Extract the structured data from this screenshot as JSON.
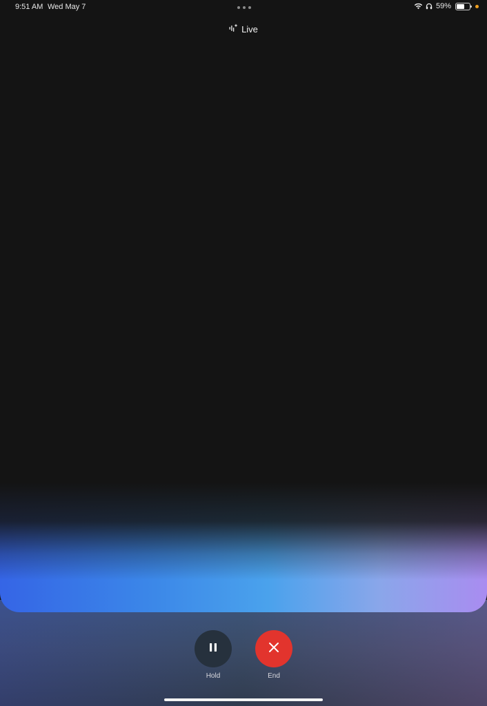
{
  "status_bar": {
    "time": "9:51 AM",
    "date": "Wed May 7",
    "battery_percent": "59%",
    "battery_level": 0.59,
    "icons": [
      "multitasking-dots-icon",
      "wifi-icon",
      "headphones-icon",
      "battery-icon",
      "privacy-indicator-dot"
    ]
  },
  "header": {
    "title": "Live",
    "icon": "live-sparkle-waveform-icon"
  },
  "controls": {
    "hold_label": "Hold",
    "hold_icon": "pause-icon",
    "end_label": "End",
    "end_icon": "close-icon"
  },
  "colors": {
    "background": "#141414",
    "end_button": "#e2342d",
    "hold_button": "#26313d",
    "glow_left": "#3565e6",
    "glow_right": "#a98cf0",
    "privacy_dot": "#f0a020"
  }
}
